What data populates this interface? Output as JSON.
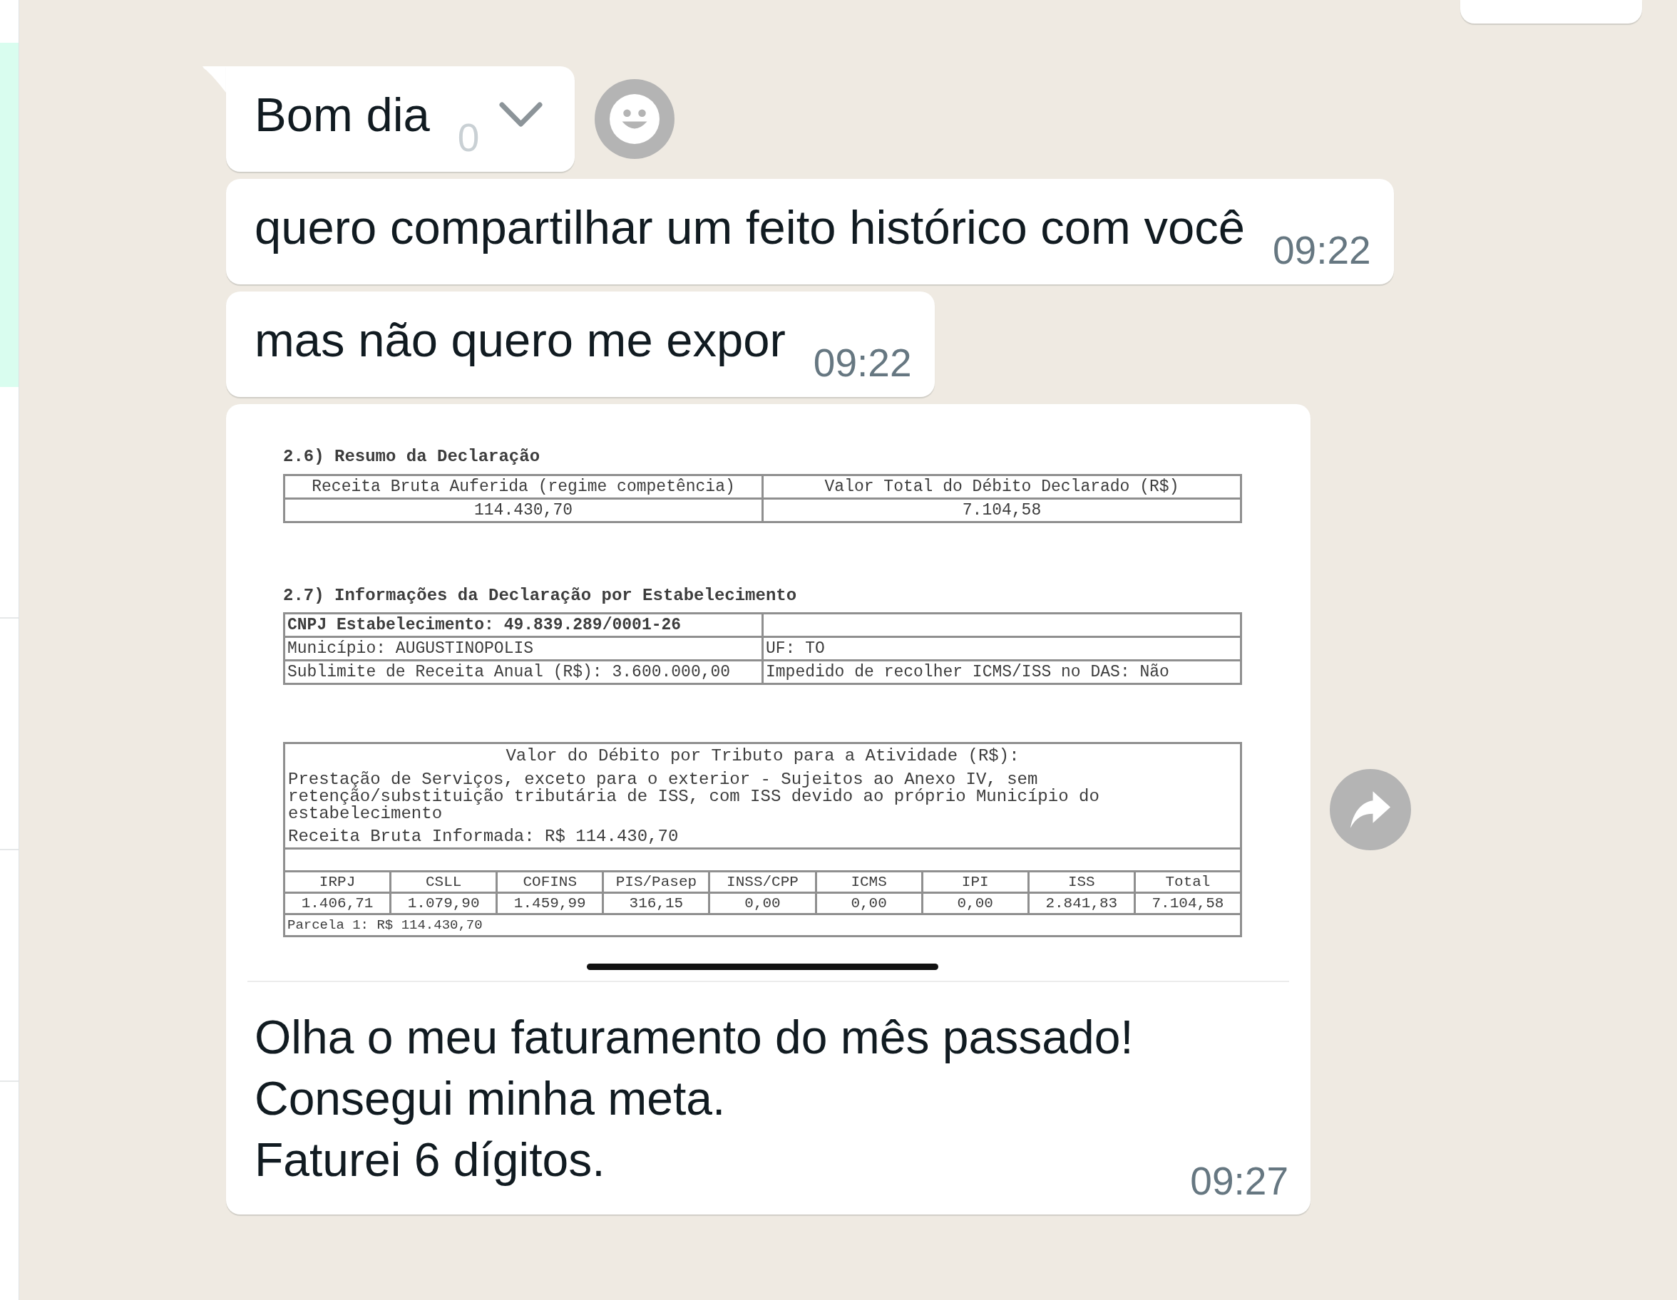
{
  "sidebar": {
    "items": [
      {
        "selected": true
      },
      {
        "selected": false
      },
      {
        "selected": false
      },
      {
        "selected": false
      }
    ]
  },
  "messages": [
    {
      "kind": "text",
      "text": "Bom dia",
      "time": "0",
      "tail": true,
      "hovered": true,
      "forward_button": false
    },
    {
      "kind": "text",
      "text": "quero compartilhar um feito histórico com você",
      "time": "09:22",
      "tail": false,
      "hovered": false,
      "forward_button": false
    },
    {
      "kind": "text",
      "text": "mas não quero me expor",
      "time": "09:22",
      "tail": false,
      "hovered": false,
      "forward_button": false
    },
    {
      "kind": "image",
      "tail": false,
      "hovered": false,
      "forward_button": true,
      "document": {
        "summary": {
          "title": "2.6) Resumo da Declaração",
          "headers": [
            "Receita Bruta Auferida (regime competência)",
            "Valor Total do Débito Declarado (R$)"
          ],
          "values": [
            "114.430,70",
            "7.104,58"
          ]
        },
        "establishment": {
          "title": "2.7) Informações da Declaração por Estabelecimento",
          "rows": [
            {
              "cells": [
                "CNPJ Estabelecimento: 49.839.289/0001-26"
              ],
              "bold": true
            },
            {
              "cells": [
                "Município: AUGUSTINOPOLIS",
                "UF: TO"
              ],
              "bold": false
            },
            {
              "cells": [
                "Sublimite de Receita Anual (R$): 3.600.000,00",
                "Impedido de recolher ICMS/ISS no DAS: Não"
              ],
              "bold": false
            }
          ]
        },
        "activity": {
          "title": "Valor do Débito por Tributo para a Atividade (R$):",
          "description": "Prestação de Serviços, exceto para o exterior - Sujeitos ao Anexo IV, sem retenção/substituição tributária de ISS, com ISS devido ao próprio Município do estabelecimento",
          "revenue": "Receita Bruta Informada: R$ 114.430,70",
          "tax_headers": [
            "IRPJ",
            "CSLL",
            "COFINS",
            "PIS/Pasep",
            "INSS/CPP",
            "ICMS",
            "IPI",
            "ISS",
            "Total"
          ],
          "tax_values": [
            "1.406,71",
            "1.079,90",
            "1.459,99",
            "316,15",
            "0,00",
            "0,00",
            "0,00",
            "2.841,83",
            "7.104,58"
          ],
          "installment": "Parcela 1: R$ 114.430,70"
        }
      },
      "caption": "Olha o meu faturamento do mês passado!\nConsegui minha meta.\nFaturei 6 dígitos.",
      "time": "09:27"
    }
  ]
}
